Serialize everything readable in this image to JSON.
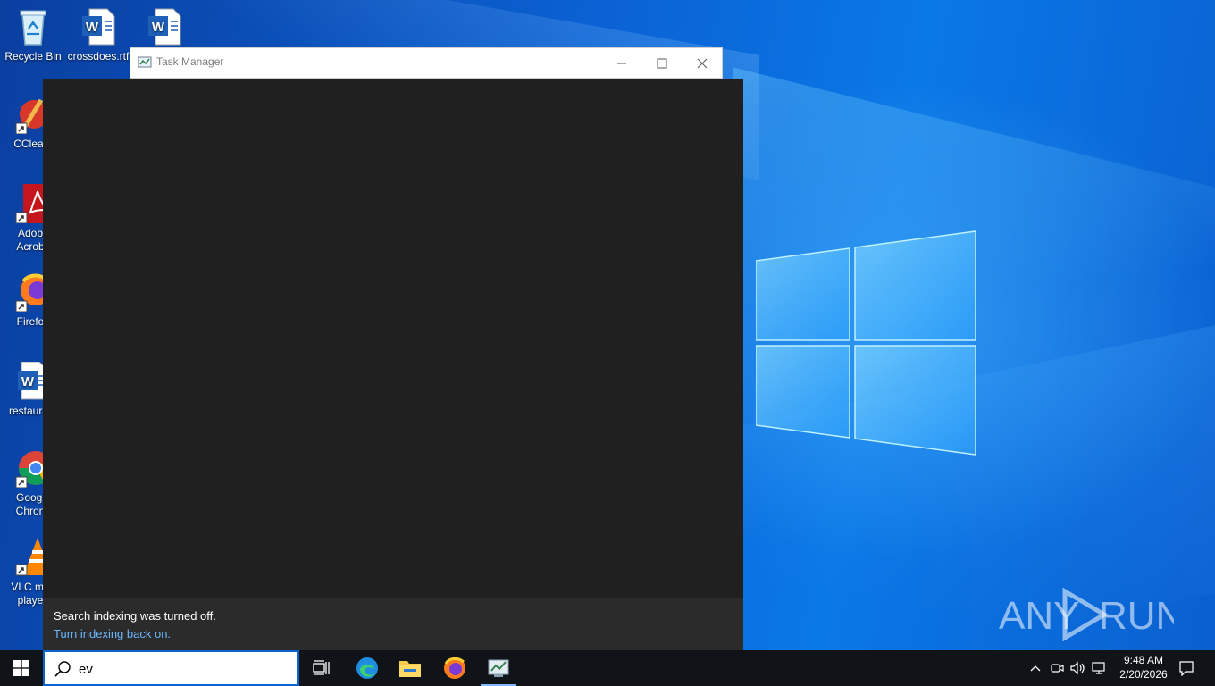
{
  "desktop": {
    "icons": [
      {
        "label": "Recycle Bin",
        "icon": "recycle-bin-icon"
      },
      {
        "label": "crossdoes.rtf",
        "icon": "word-document-icon"
      },
      {
        "label": "",
        "icon": "word-document-icon"
      },
      {
        "label": "CClear",
        "icon": "ccleaner-icon"
      },
      {
        "label": "Adob\nAcrob",
        "icon": "acrobat-icon"
      },
      {
        "label": "Firefo",
        "icon": "firefox-icon"
      },
      {
        "label": "restaura",
        "icon": "word-document-icon"
      },
      {
        "label": "Googl\nChron",
        "icon": "chrome-icon"
      },
      {
        "label": "VLC me\nplaye",
        "icon": "vlc-icon"
      }
    ],
    "watermark": "ANY RUN"
  },
  "window": {
    "title": "Task Manager"
  },
  "search_flyout": {
    "message": "Search indexing was turned off.",
    "link": "Turn indexing back on."
  },
  "taskbar": {
    "search_value": "ev",
    "pinned": [
      "task-view-icon",
      "edge-icon",
      "file-explorer-icon",
      "firefox-icon",
      "task-manager-icon"
    ],
    "time": "9:48 AM",
    "date": "2/20/2026"
  },
  "colors": {
    "accent": "#0a64d0",
    "flyout_bg": "#202020",
    "link": "#6cb8ff",
    "taskbar": "#101418"
  }
}
